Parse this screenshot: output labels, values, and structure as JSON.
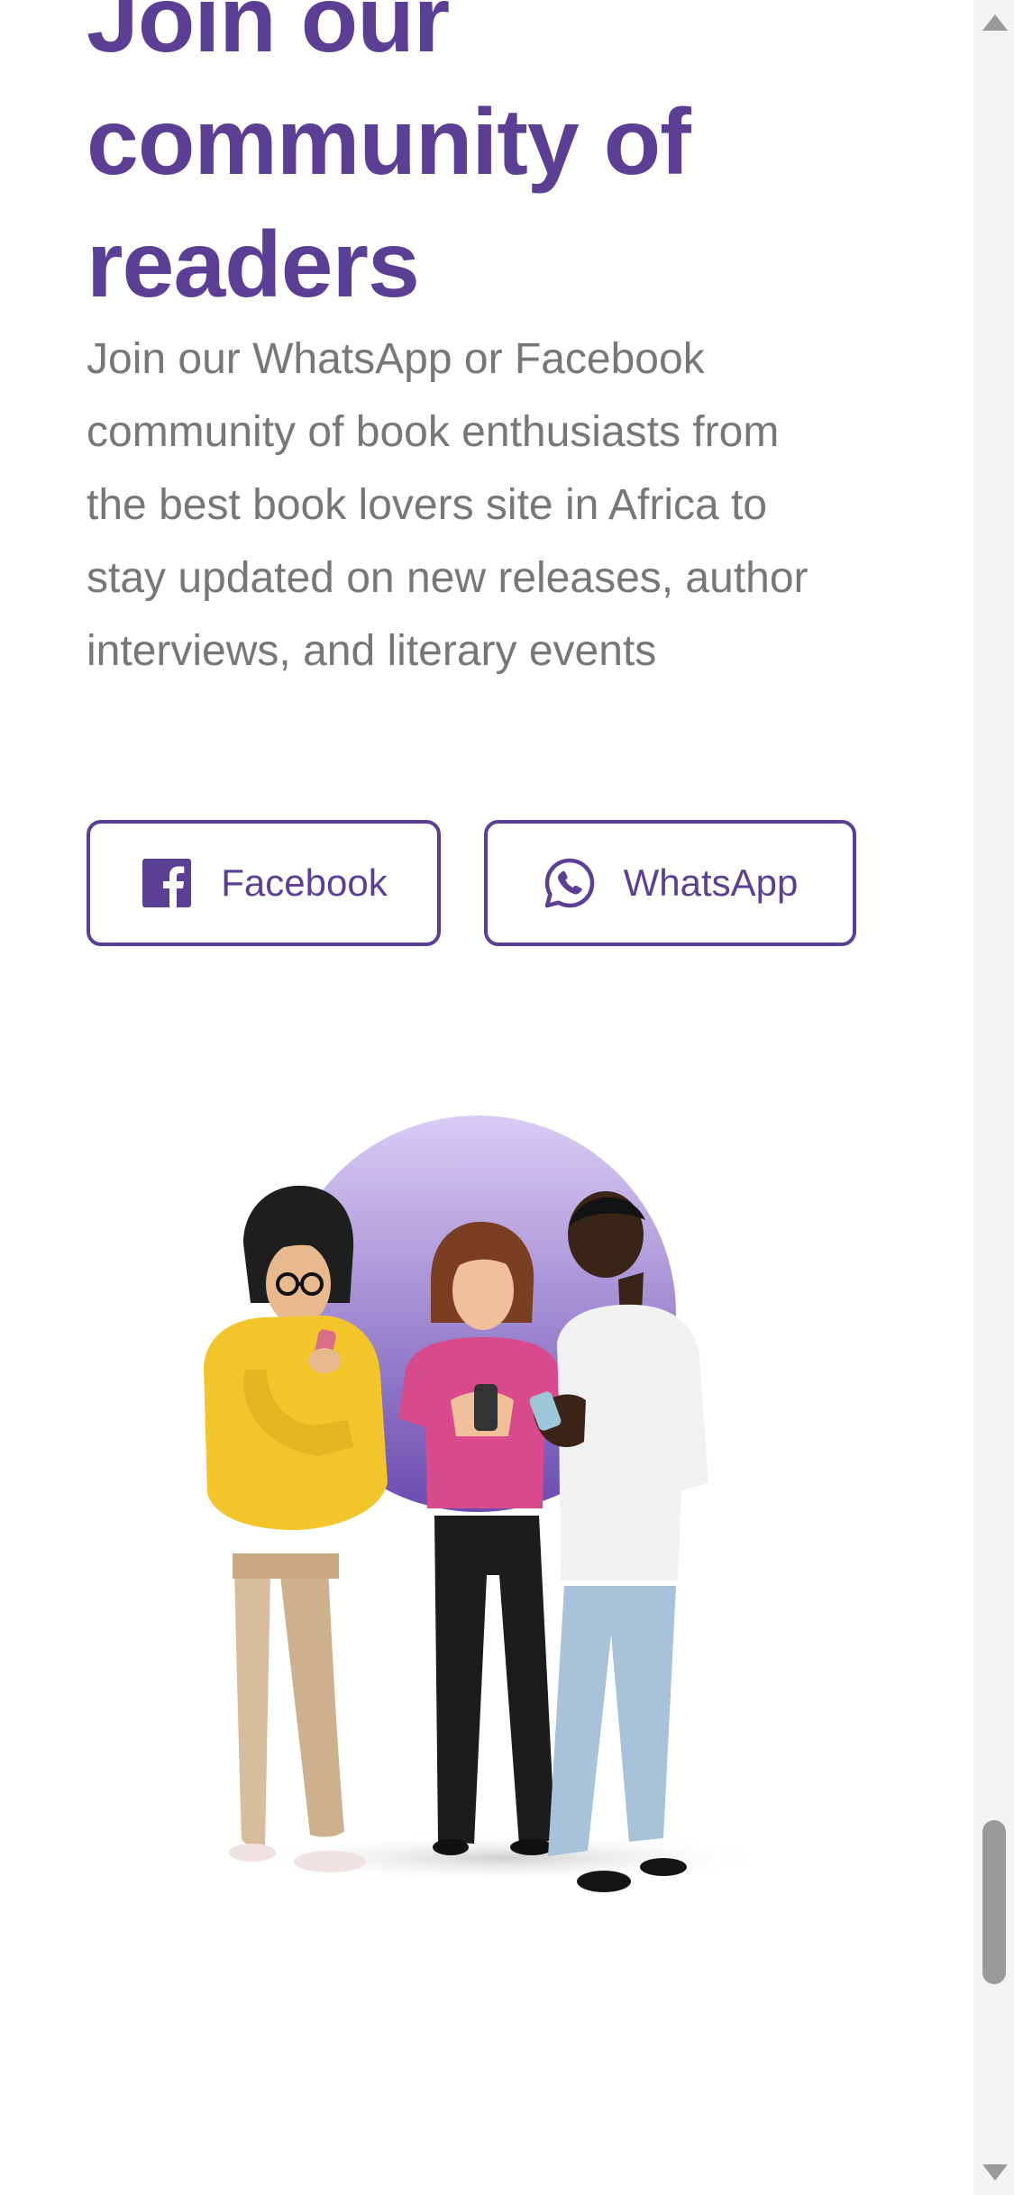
{
  "community": {
    "heading_lines": [
      "Join our",
      "community of",
      "readers"
    ],
    "description_lines": [
      "Join our WhatsApp or Facebook",
      "community of book enthusiasts from",
      "the best book lovers site in Africa to",
      "stay updated on new releases, author",
      "interviews, and literary events"
    ],
    "buttons": {
      "facebook_label": "Facebook",
      "facebook_icon": "facebook-icon",
      "whatsapp_label": "WhatsApp",
      "whatsapp_icon": "whatsapp-icon"
    }
  },
  "colors": {
    "brand_purple": "#5b3f95",
    "body_text": "#777777",
    "circle_light": "#d8ccf4",
    "circle_dark": "#6b4bb0"
  }
}
